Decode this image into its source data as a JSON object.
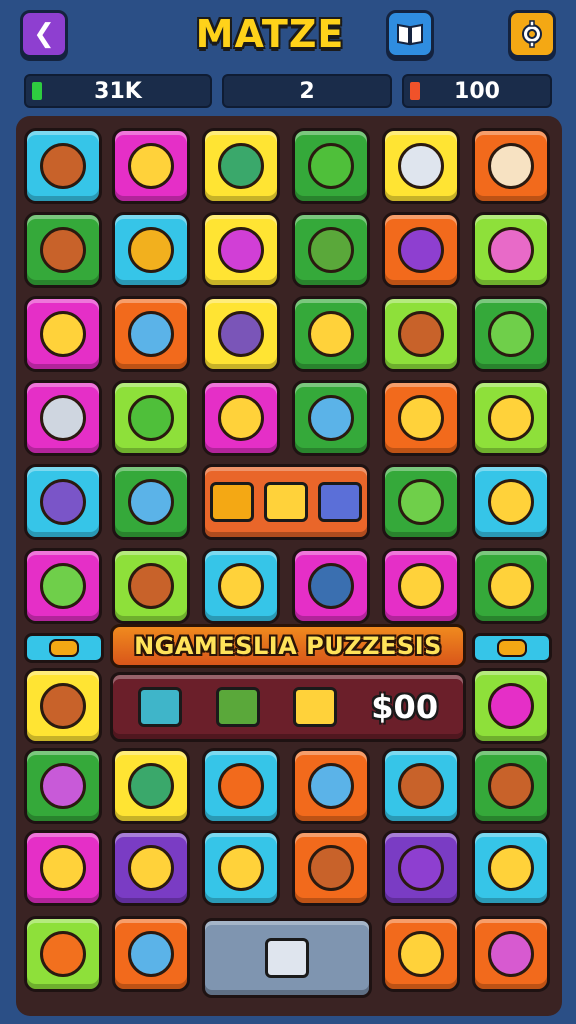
{
  "header": {
    "title": "MATZE",
    "back_icon": "chevron-left-icon",
    "book_icon": "book-icon",
    "settings_icon": "gear-icon"
  },
  "stats": [
    {
      "value": "31K",
      "accent": "#2ecc40"
    },
    {
      "value": "2",
      "accent": ""
    },
    {
      "value": "100",
      "accent": "#f0522a"
    }
  ],
  "banner": {
    "text": "NGAMESLIA PUZZESIS"
  },
  "shop": {
    "price": "$00"
  },
  "colors": {
    "cyan": "#36c5e8",
    "magenta": "#e52fc7",
    "yellow": "#ffe433",
    "green": "#35a93a",
    "orange": "#f26a1c",
    "lime": "#8ee03a",
    "purple": "#7a3cc4"
  }
}
